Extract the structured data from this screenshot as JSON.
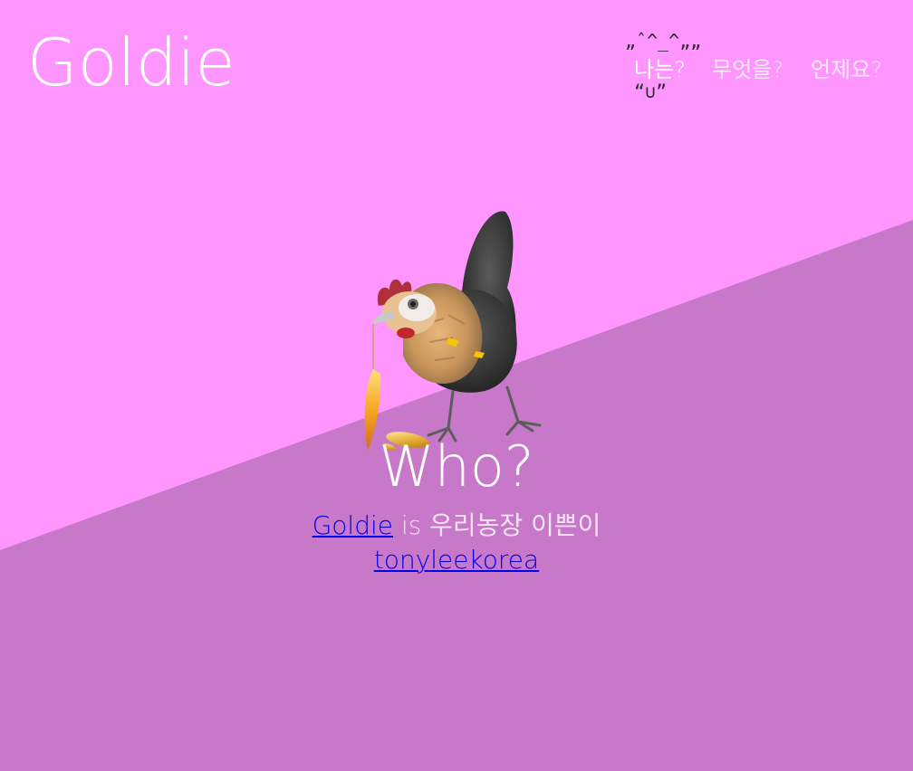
{
  "brand": {
    "title": "Goldie"
  },
  "nav": {
    "face_top": "„ˆ^_^„„",
    "face_bottom": "“∪”",
    "items": [
      {
        "label": "나는?",
        "active": true
      },
      {
        "label": "무엇을?",
        "active": false
      },
      {
        "label": "언제요?",
        "active": false
      }
    ]
  },
  "hero": {
    "headline": "Who?",
    "link_name": "Goldie",
    "connector": " is ",
    "description": "우리농장 이쁜이",
    "author_link": "tonyleekorea"
  },
  "colors": {
    "background_light": "#FF96FF",
    "background_dark": "#C878C8",
    "text": "#FFFFFF",
    "link": "#0000EE"
  },
  "icons": {
    "illustration": "hen-illustration"
  }
}
